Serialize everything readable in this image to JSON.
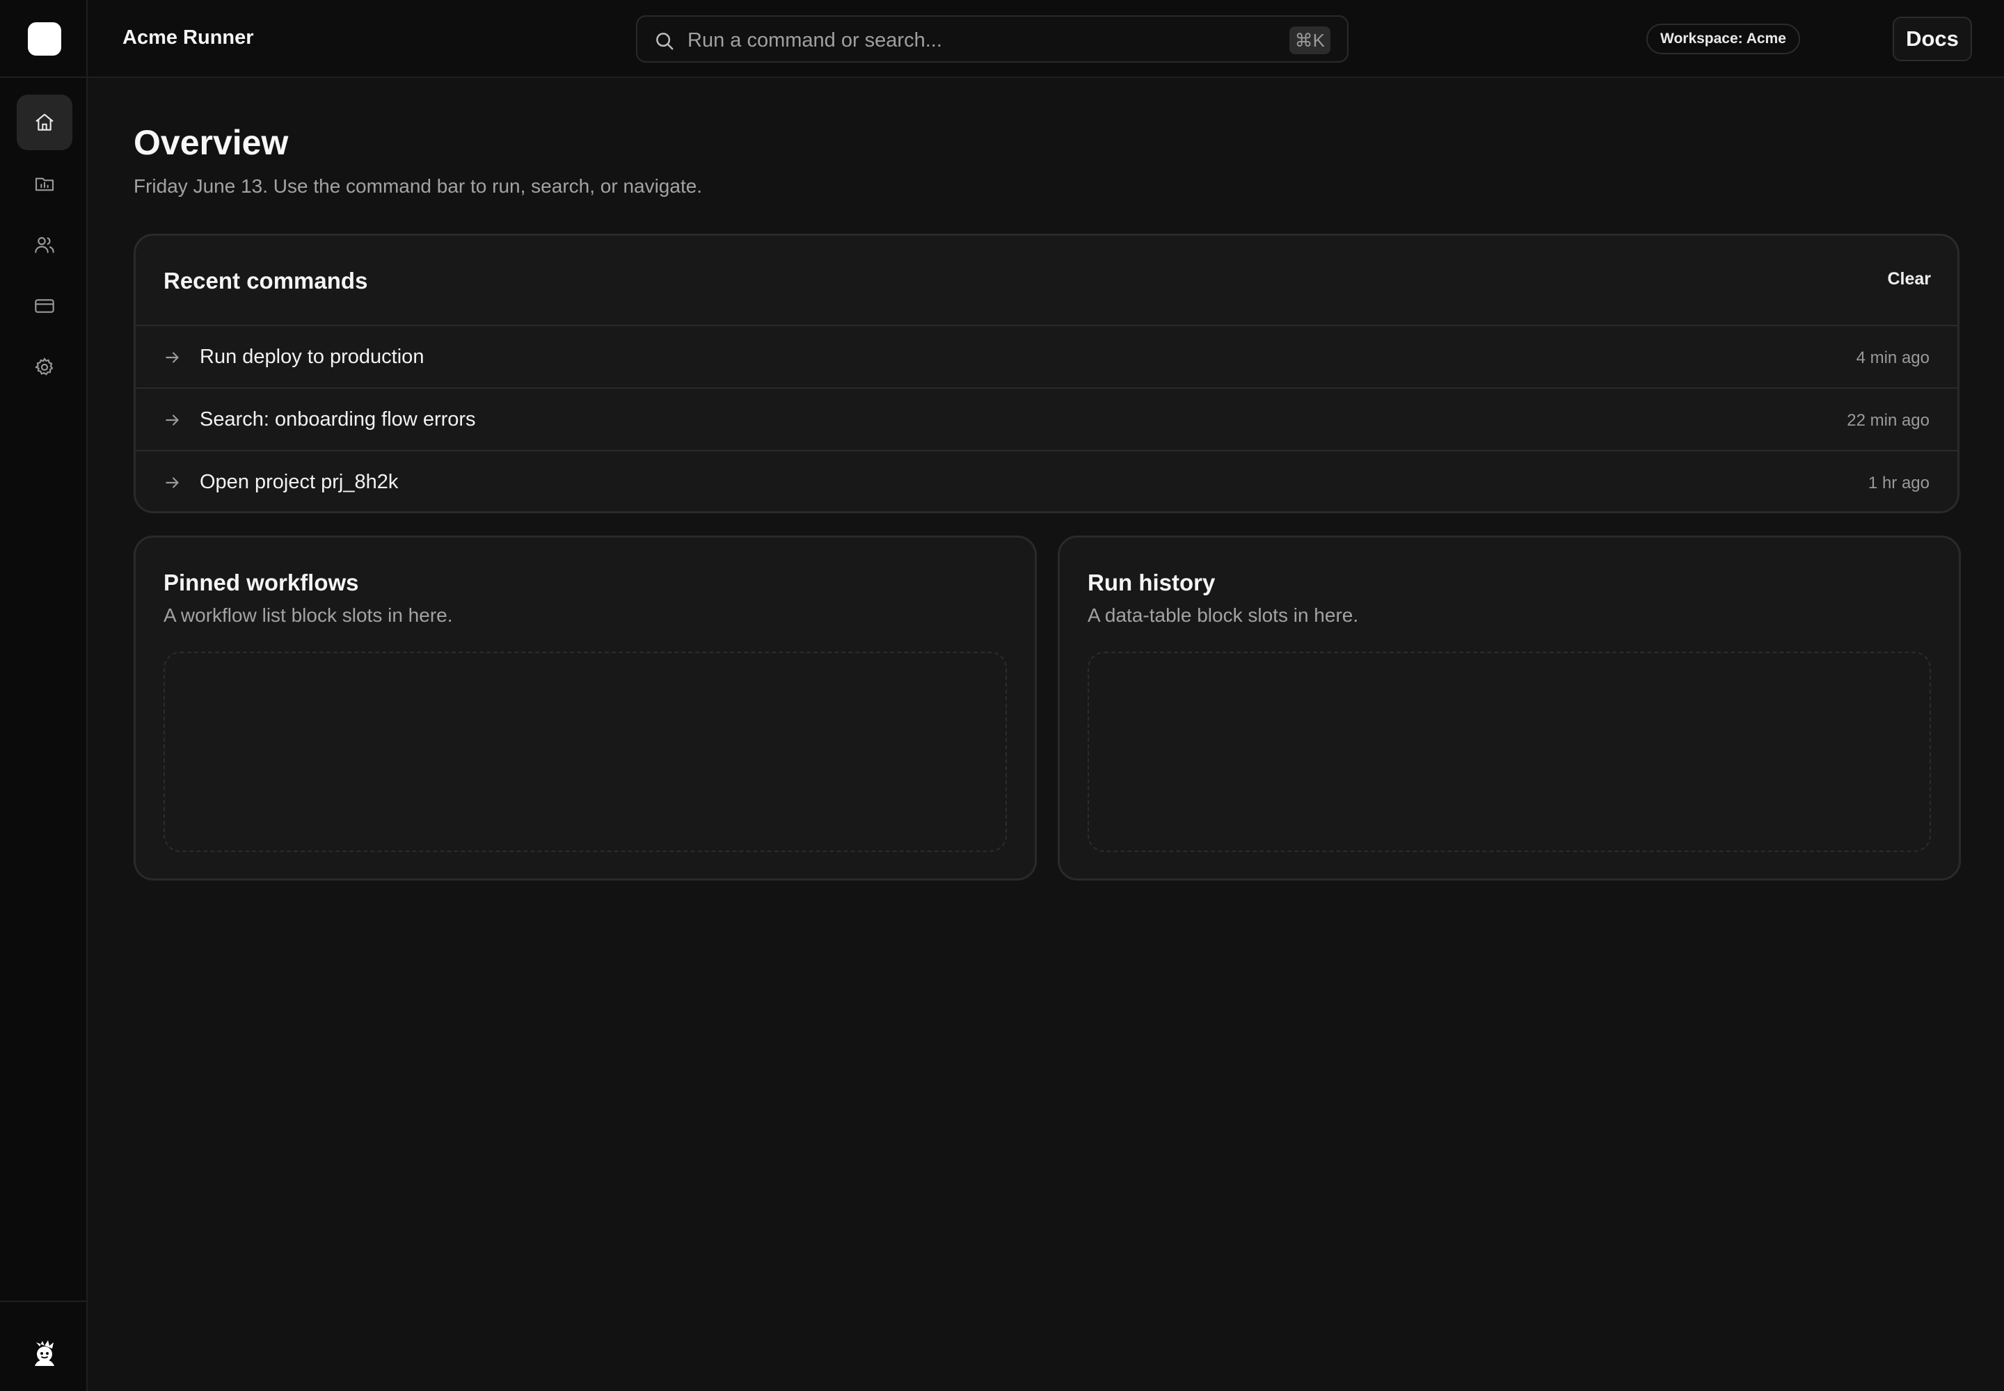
{
  "app": {
    "title": "Acme Runner"
  },
  "command_bar": {
    "placeholder": "Run a command or search...",
    "shortcut": "⌘K"
  },
  "header": {
    "workspace_badge": "Workspace: Acme",
    "docs_label": "Docs"
  },
  "sidebar": {
    "items": [
      {
        "name": "home",
        "icon": "home-icon",
        "active": true
      },
      {
        "name": "projects",
        "icon": "folder-chart-icon",
        "active": false
      },
      {
        "name": "team",
        "icon": "users-icon",
        "active": false
      },
      {
        "name": "billing",
        "icon": "credit-card-icon",
        "active": false
      },
      {
        "name": "settings",
        "icon": "gear-icon",
        "active": false
      }
    ],
    "footer_icon": "mascot-icon"
  },
  "page": {
    "title": "Overview",
    "subtitle": "Friday June 13. Use the command bar to run, search, or navigate."
  },
  "recent_commands": {
    "title": "Recent commands",
    "clear_label": "Clear",
    "items": [
      {
        "label": "Run deploy to production",
        "time": "4 min ago"
      },
      {
        "label": "Search: onboarding flow errors",
        "time": "22 min ago"
      },
      {
        "label": "Open project prj_8h2k",
        "time": "1 hr ago"
      }
    ]
  },
  "pinned_workflows": {
    "title": "Pinned workflows",
    "description": "A workflow list block slots in here."
  },
  "run_history": {
    "title": "Run history",
    "description": "A data-table block slots in here."
  },
  "colors": {
    "background": "#121212",
    "sidebar": "#0b0b0b",
    "card": "#181818",
    "border": "#2a2a2a",
    "text_muted": "#a3a3a3"
  }
}
